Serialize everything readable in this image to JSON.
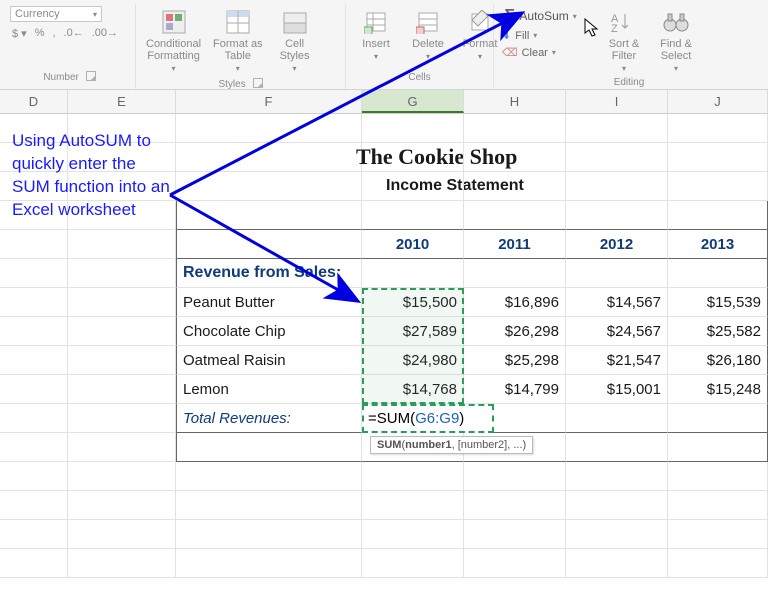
{
  "ribbon": {
    "number": {
      "format_dropdown": "Currency",
      "group_label": "Number"
    },
    "styles": {
      "cond_fmt": "Conditional\nFormatting",
      "fmt_table": "Format as\nTable",
      "cell_styles": "Cell\nStyles",
      "group_label": "Styles"
    },
    "cells": {
      "insert": "Insert",
      "delete": "Delete",
      "format": "Format",
      "group_label": "Cells"
    },
    "editing": {
      "autosum": "AutoSum",
      "fill": "Fill",
      "clear": "Clear",
      "sort_filter": "Sort &\nFilter",
      "find_select": "Find &\nSelect",
      "group_label": "Editing"
    }
  },
  "columns": [
    "D",
    "E",
    "F",
    "G",
    "H",
    "I",
    "J"
  ],
  "sheet": {
    "title": "The Cookie Shop",
    "subtitle": "Income Statement",
    "years": [
      "2010",
      "2011",
      "2012",
      "2013"
    ],
    "section": "Revenue from Sales:",
    "rows": [
      {
        "label": "Peanut Butter",
        "vals": [
          "$15,500",
          "$16,896",
          "$14,567",
          "$15,539"
        ]
      },
      {
        "label": "Chocolate Chip",
        "vals": [
          "$27,589",
          "$26,298",
          "$24,567",
          "$25,582"
        ]
      },
      {
        "label": "Oatmeal Raisin",
        "vals": [
          "$24,980",
          "$25,298",
          "$21,547",
          "$26,180"
        ]
      },
      {
        "label": "Lemon",
        "vals": [
          "$14,768",
          "$14,799",
          "$15,001",
          "$15,248"
        ]
      }
    ],
    "total_label": "Total Revenues:",
    "formula_prefix": "=SUM(",
    "formula_ref": "G6:G9",
    "formula_suffix": ")",
    "tooltip_fn": "SUM",
    "tooltip_arg1": "number1",
    "tooltip_rest": ", [number2], ...)"
  },
  "annotation": "Using AutoSUM to quickly enter the SUM function into an Excel worksheet"
}
